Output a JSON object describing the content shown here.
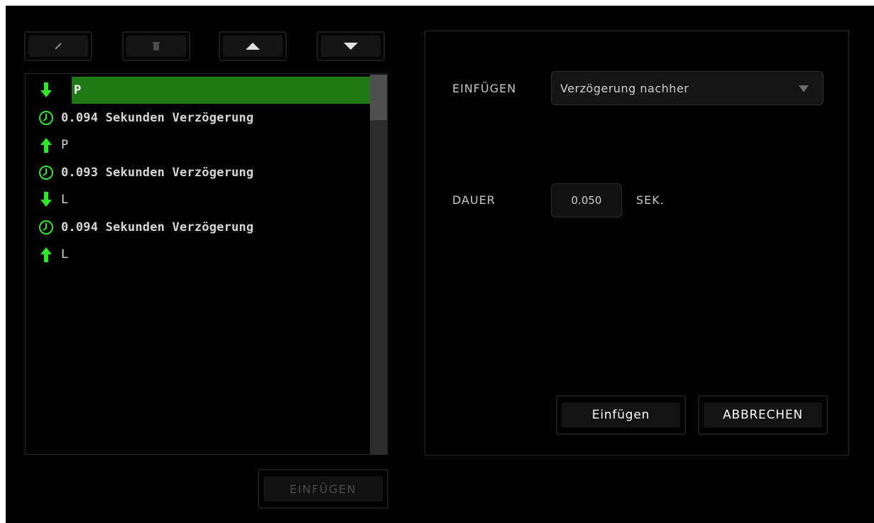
{
  "toolbar": {
    "edit_icon": "pencil-icon",
    "delete_icon": "trash-icon",
    "up_icon": "triangle-up-icon",
    "down_icon": "triangle-down-icon"
  },
  "macro_list": {
    "items": [
      {
        "type": "key-down",
        "text": "P",
        "icon": "arrow-down-icon",
        "selected": true
      },
      {
        "type": "delay",
        "text": "0.094 Sekunden Verzögerung",
        "icon": "clock-icon"
      },
      {
        "type": "key-up",
        "text": "P",
        "icon": "arrow-up-icon"
      },
      {
        "type": "delay",
        "text": "0.093 Sekunden Verzögerung",
        "icon": "clock-icon"
      },
      {
        "type": "key-down",
        "text": "L",
        "icon": "arrow-down-icon"
      },
      {
        "type": "delay",
        "text": "0.094 Sekunden Verzögerung",
        "icon": "clock-icon"
      },
      {
        "type": "key-up",
        "text": "L",
        "icon": "arrow-up-icon"
      }
    ],
    "insert_label": "EINFÜGEN"
  },
  "editor": {
    "insert_label": "EINFÜGEN",
    "insert_option": "Verzögerung nachher",
    "duration_label": "DAUER",
    "duration_value": "0.050",
    "duration_unit": "SEK.",
    "confirm_label": "Einfügen",
    "cancel_label": "ABBRECHEN"
  },
  "colors": {
    "accent": "#2ee82a",
    "selection": "#1d7a15"
  }
}
